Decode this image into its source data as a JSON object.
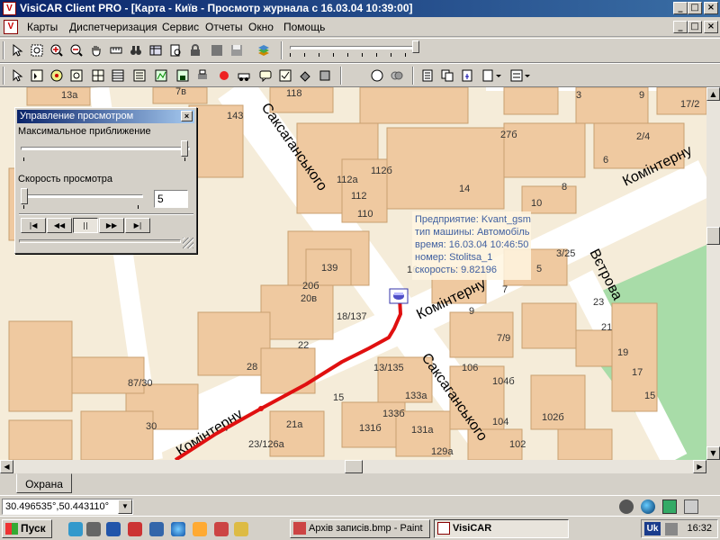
{
  "window": {
    "title": "VisiCAR Client PRO - [Карта - Київ - Просмотр журнала с 16.03.04 10:39:00]",
    "controls": {
      "minimize": "_",
      "maximize": "□",
      "close": "×"
    },
    "mdi_controls": {
      "minimize": "_",
      "restore": "□",
      "close": "×"
    }
  },
  "menu": {
    "items": [
      "Карты",
      "Диспетчеризация",
      "Сервис",
      "Отчеты",
      "Окно",
      "Помощь"
    ]
  },
  "toolbar1": {
    "icons": [
      "pointer-icon",
      "zoom-window-icon",
      "zoom-in-icon",
      "zoom-out-icon",
      "pan-hand-icon",
      "ruler-icon",
      "binoculars-icon",
      "layers-icon",
      "print-preview-icon",
      "lock-icon",
      "stop-icon",
      "save-icon",
      "layers-stack-icon"
    ]
  },
  "toolbar2": {
    "icons": [
      "pointer-icon",
      "select-icon",
      "target-icon",
      "zoom-area-icon",
      "grid-icon",
      "table-icon",
      "list-icon",
      "route-icon",
      "save-icon",
      "print-icon",
      "record-icon",
      "car-icon",
      "message-icon",
      "route-check-icon",
      "fill-icon",
      "clear-icon",
      "circle-icon",
      "cluster-icon",
      "report-icon",
      "copy-icon",
      "export-icon",
      "dropdown-report-icon",
      "dropdown-list-icon"
    ]
  },
  "dialog": {
    "title": "Управление просмотром",
    "close": "×",
    "max_zoom_label": "Максимальное приближение",
    "max_zoom_level": 1.0,
    "speed_label": "Скорость просмотра",
    "speed_level": 0.0,
    "speed_value": "5",
    "buttons": [
      "|◀",
      "◀◀",
      "||",
      "▶▶",
      "▶|"
    ],
    "button_names": [
      "first-button",
      "rewind-button",
      "pause-button",
      "forward-button",
      "last-button"
    ]
  },
  "map": {
    "streets": [
      "Саксаганського",
      "Комінтерну",
      "Комінтерну",
      "Саксаганського",
      "Вєтрова",
      "Комінтерну"
    ],
    "buildings": [
      "13а",
      "7в",
      "118",
      "3",
      "9",
      "17/2",
      "143",
      "27б",
      "6",
      "2/4",
      "112а",
      "112б",
      "8",
      "112",
      "14",
      "10",
      "110",
      "3/25",
      "139",
      "16",
      "5",
      "20б",
      "20в",
      "7",
      "23",
      "18/137",
      "9",
      "21",
      "22",
      "7/9",
      "19",
      "87/30",
      "28",
      "13/135",
      "106",
      "17",
      "15",
      "133а",
      "104б",
      "15",
      "133б",
      "102б",
      "30",
      "21а",
      "131б",
      "131а",
      "104",
      "23/126а",
      "129а",
      "102"
    ],
    "tooltip": {
      "line1": "Предприятие: Kvant_gsm",
      "line2": "тип машины: Автомобіль",
      "line3": "время: 16.03.04 10:46:50",
      "line4": "номер: Stolitsa_1",
      "line5": "скорость: 9.82196"
    },
    "colors": {
      "background": "#f5ecd9",
      "building": "#efc9a0",
      "road": "#ffffff",
      "park": "#a8dca8",
      "track": "#e01010"
    }
  },
  "tabs": {
    "ohrana": "Охрана"
  },
  "status": {
    "coordinates": "30.496535°,50.443110°"
  },
  "taskbar": {
    "start": "Пуск",
    "tasks": [
      "Архів записів.bmp - Paint",
      "VisiCAR"
    ],
    "lang": "Uk",
    "clock": "16:32"
  }
}
